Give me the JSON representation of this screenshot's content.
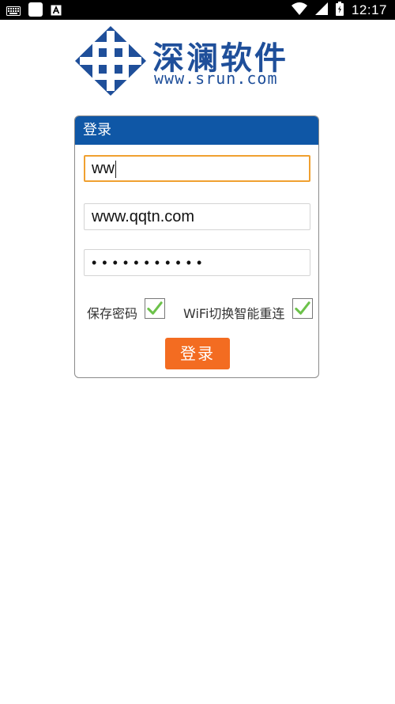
{
  "status_bar": {
    "time": "12:17",
    "left_icons": [
      "keyboard-icon",
      "app-icon",
      "text-a-icon"
    ],
    "right_icons": [
      "wifi-icon",
      "signal-icon",
      "battery-icon"
    ]
  },
  "logo": {
    "title": "深澜软件",
    "url": "www.srun.com",
    "brand_color": "#1f4f9a"
  },
  "login_panel": {
    "header": "登录",
    "header_color": "#0f57a6",
    "username_value": "ww",
    "server_value": "www.qqtn.com",
    "password_value": "•••••••••••",
    "save_password_label": "保存密码",
    "save_password_checked": true,
    "wifi_reconnect_label": "WiFi切换智能重连",
    "wifi_reconnect_checked": true,
    "login_button": "登录",
    "button_color": "#f36c21",
    "focus_color": "#f0a030"
  }
}
